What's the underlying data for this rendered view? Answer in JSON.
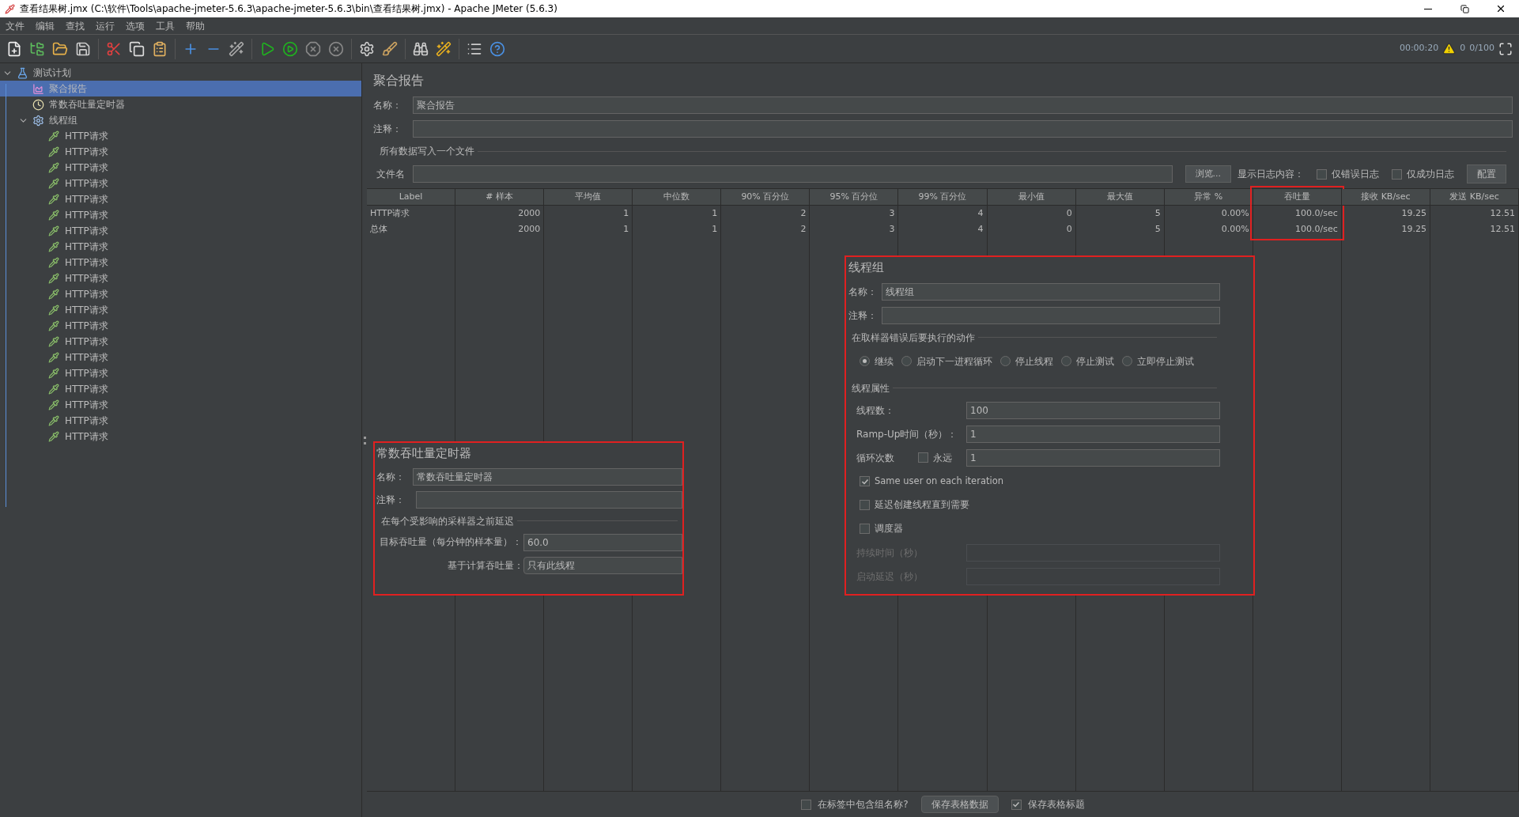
{
  "window": {
    "title": "查看结果树.jmx (C:\\软件\\Tools\\apache-jmeter-5.6.3\\apache-jmeter-5.6.3\\bin\\查看结果树.jmx) - Apache JMeter (5.6.3)"
  },
  "menu": [
    "文件",
    "编辑",
    "查找",
    "运行",
    "选项",
    "工具",
    "帮助"
  ],
  "status": {
    "elapsed": "00:00:20",
    "warnings": "0",
    "threads": "0/100"
  },
  "tree": [
    {
      "label": "测试计划",
      "kind": "plan",
      "expanded": true,
      "selected": false,
      "children": [
        {
          "label": "聚合报告",
          "kind": "report",
          "selected": true
        },
        {
          "label": "常数吞吐量定时器",
          "kind": "timer",
          "selected": false
        },
        {
          "label": "线程组",
          "kind": "group",
          "expanded": true,
          "selected": false,
          "children": [
            {
              "label": "HTTP请求",
              "kind": "http",
              "selected": false
            },
            {
              "label": "HTTP请求",
              "kind": "http",
              "selected": false
            },
            {
              "label": "HTTP请求",
              "kind": "http",
              "selected": false
            },
            {
              "label": "HTTP请求",
              "kind": "http",
              "selected": false
            },
            {
              "label": "HTTP请求",
              "kind": "http",
              "selected": false
            },
            {
              "label": "HTTP请求",
              "kind": "http",
              "selected": false
            },
            {
              "label": "HTTP请求",
              "kind": "http",
              "selected": false
            },
            {
              "label": "HTTP请求",
              "kind": "http",
              "selected": false
            },
            {
              "label": "HTTP请求",
              "kind": "http",
              "selected": false
            },
            {
              "label": "HTTP请求",
              "kind": "http",
              "selected": false
            },
            {
              "label": "HTTP请求",
              "kind": "http",
              "selected": false
            },
            {
              "label": "HTTP请求",
              "kind": "http",
              "selected": false
            },
            {
              "label": "HTTP请求",
              "kind": "http",
              "selected": false
            },
            {
              "label": "HTTP请求",
              "kind": "http",
              "selected": false
            },
            {
              "label": "HTTP请求",
              "kind": "http",
              "selected": false
            },
            {
              "label": "HTTP请求",
              "kind": "http",
              "selected": false
            },
            {
              "label": "HTTP请求",
              "kind": "http",
              "selected": false
            },
            {
              "label": "HTTP请求",
              "kind": "http",
              "selected": false
            },
            {
              "label": "HTTP请求",
              "kind": "http",
              "selected": false
            },
            {
              "label": "HTTP请求",
              "kind": "http",
              "selected": false
            }
          ]
        }
      ]
    }
  ],
  "report": {
    "title": "聚合报告",
    "name_label": "名称：",
    "name_value": "聚合报告",
    "comment_label": "注释：",
    "file_section": "所有数据写入一个文件",
    "file_label": "文件名",
    "browse_button": "浏览...",
    "log_label": "显示日志内容：",
    "log_options": [
      {
        "label": "仅错误日志",
        "checked": false
      },
      {
        "label": "仅成功日志",
        "checked": false
      }
    ],
    "config_button": "配置"
  },
  "table": {
    "columns": [
      {
        "label": "Label",
        "highlighted": false
      },
      {
        "label": "# 样本",
        "highlighted": false
      },
      {
        "label": "平均值",
        "highlighted": false
      },
      {
        "label": "中位数",
        "highlighted": false
      },
      {
        "label": "90% 百分位",
        "highlighted": false
      },
      {
        "label": "95% 百分位",
        "highlighted": false
      },
      {
        "label": "99% 百分位",
        "highlighted": false
      },
      {
        "label": "最小值",
        "highlighted": false
      },
      {
        "label": "最大值",
        "highlighted": false
      },
      {
        "label": "异常 %",
        "highlighted": false
      },
      {
        "label": "吞吐量",
        "highlighted": true
      },
      {
        "label": "接收 KB/sec",
        "highlighted": false
      },
      {
        "label": "发送 KB/sec",
        "highlighted": false
      }
    ],
    "rows": [
      [
        "HTTP请求",
        "2000",
        "1",
        "1",
        "2",
        "3",
        "4",
        "0",
        "5",
        "0.00%",
        "100.0/sec",
        "19.25",
        "12.51"
      ],
      [
        "总体",
        "2000",
        "1",
        "1",
        "2",
        "3",
        "4",
        "0",
        "5",
        "0.00%",
        "100.0/sec",
        "19.25",
        "12.51"
      ]
    ]
  },
  "bottom": {
    "include_group": {
      "label": "在标签中包含组名称?",
      "checked": false
    },
    "save_data_button": "保存表格数据",
    "save_header": {
      "label": "保存表格标题",
      "checked": true
    }
  },
  "timer_panel": {
    "title": "常数吞吐量定时器",
    "name_label": "名称：",
    "name_value": "常数吞吐量定时器",
    "comment_label": "注释：",
    "section": "在每个受影响的采样器之前延迟",
    "target_label": "目标吞吐量（每分钟的样本量）：",
    "target_value": "60.0",
    "based_label": "基于计算吞吐量：",
    "based_value": "只有此线程"
  },
  "thread_group": {
    "title": "线程组",
    "name_label": "名称：",
    "name_value": "线程组",
    "comment_label": "注释：",
    "error_section": "在取样器错误后要执行的动作",
    "error_actions": [
      {
        "label": "继续",
        "selected": true
      },
      {
        "label": "启动下一进程循环",
        "selected": false
      },
      {
        "label": "停止线程",
        "selected": false
      },
      {
        "label": "停止测试",
        "selected": false
      },
      {
        "label": "立即停止测试",
        "selected": false
      }
    ],
    "props_section": "线程属性",
    "fields": [
      {
        "label": "线程数：",
        "value": "100",
        "disabled": false
      },
      {
        "label": "Ramp-Up时间（秒）：",
        "value": "1",
        "disabled": false
      }
    ],
    "loop": {
      "label": "循环次数",
      "forever": {
        "label": "永远",
        "checked": false
      },
      "value": "1"
    },
    "options": [
      {
        "label": "Same user on each iteration",
        "checked": true
      },
      {
        "label": "延迟创建线程直到需要",
        "checked": false
      },
      {
        "label": "调度器",
        "checked": false
      }
    ],
    "schedule_fields": [
      {
        "label": "持续时间（秒）",
        "disabled": true
      },
      {
        "label": "启动延迟（秒）",
        "disabled": true
      }
    ]
  }
}
